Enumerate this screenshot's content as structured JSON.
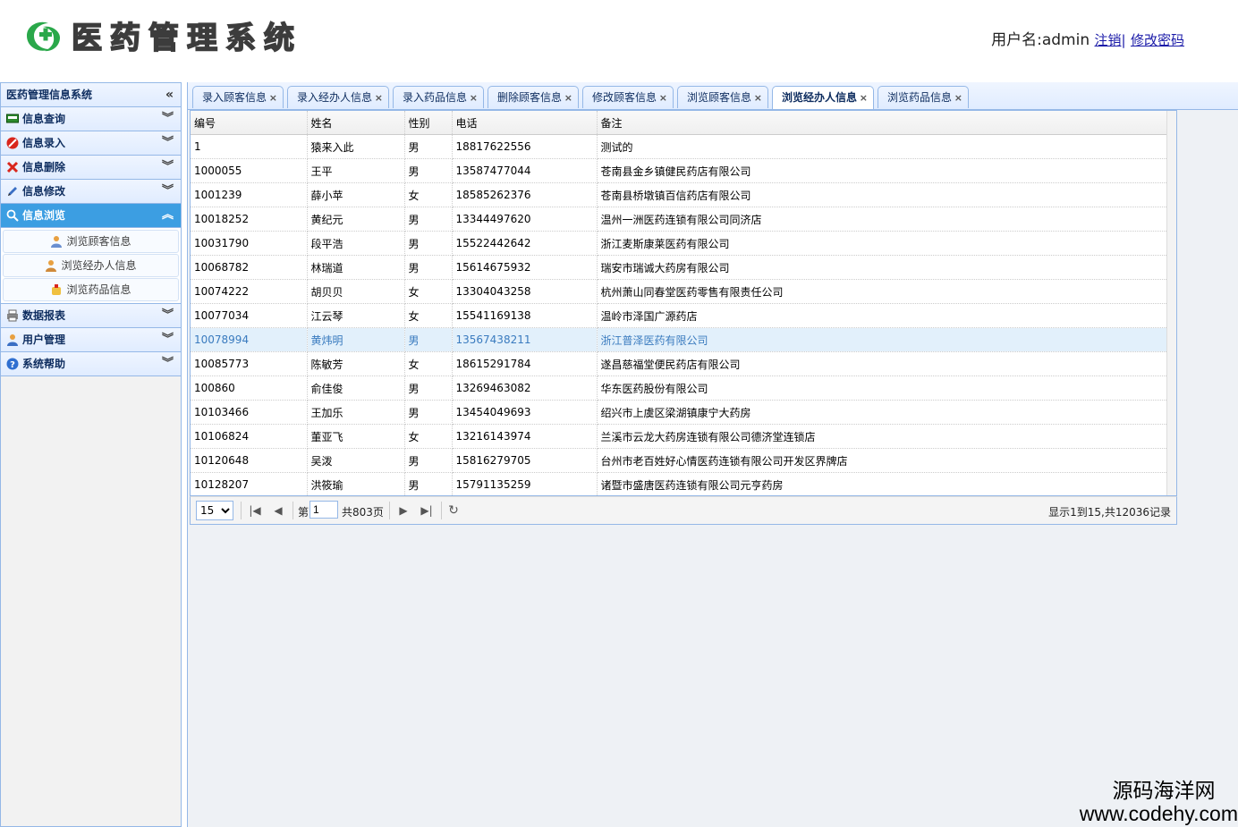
{
  "header": {
    "title": "医药管理系统",
    "user_label": "用户名:admin",
    "logout": "注销",
    "sep": "|",
    "change_password": "修改密码"
  },
  "sidebar": {
    "title": "医药管理信息系统",
    "collapse_icon": "«",
    "sections": [
      {
        "label": "信息查询",
        "icon": "monitor-icon"
      },
      {
        "label": "信息录入",
        "icon": "stop-icon"
      },
      {
        "label": "信息删除",
        "icon": "delete-icon"
      },
      {
        "label": "信息修改",
        "icon": "pencil-icon"
      },
      {
        "label": "信息浏览",
        "icon": "search-icon",
        "active": true
      },
      {
        "label": "数据报表",
        "icon": "printer-icon"
      },
      {
        "label": "用户管理",
        "icon": "user-icon"
      },
      {
        "label": "系统帮助",
        "icon": "help-icon"
      }
    ],
    "subitems": [
      {
        "label": "浏览顾客信息",
        "icon": "customer-icon"
      },
      {
        "label": "浏览经办人信息",
        "icon": "agent-icon"
      },
      {
        "label": "浏览药品信息",
        "icon": "medicine-icon"
      }
    ]
  },
  "tabs": [
    {
      "label": "录入顾客信息"
    },
    {
      "label": "录入经办人信息"
    },
    {
      "label": "录入药品信息"
    },
    {
      "label": "删除顾客信息"
    },
    {
      "label": "修改顾客信息"
    },
    {
      "label": "浏览顾客信息"
    },
    {
      "label": "浏览经办人信息",
      "active": true
    },
    {
      "label": "浏览药品信息"
    }
  ],
  "grid": {
    "columns": [
      "编号",
      "姓名",
      "性别",
      "电话",
      "备注"
    ],
    "rows": [
      [
        "1",
        "猿来入此",
        "男",
        "18817622556",
        "测试的"
      ],
      [
        "1000055",
        "王平",
        "男",
        "13587477044",
        "苍南县金乡镇健民药店有限公司"
      ],
      [
        "1001239",
        "薛小苹",
        "女",
        "18585262376",
        "苍南县桥墩镇百信药店有限公司"
      ],
      [
        "10018252",
        "黄纪元",
        "男",
        "13344497620",
        "温州一洲医药连锁有限公司同济店"
      ],
      [
        "10031790",
        "段平浩",
        "男",
        "15522442642",
        "浙江麦斯康莱医药有限公司"
      ],
      [
        "10068782",
        "林瑞道",
        "男",
        "15614675932",
        "瑞安市瑞诚大药房有限公司"
      ],
      [
        "10074222",
        "胡贝贝",
        "女",
        "13304043258",
        "杭州萧山同春堂医药零售有限责任公司"
      ],
      [
        "10077034",
        "江云琴",
        "女",
        "15541169138",
        "温岭市泽国广源药店"
      ],
      [
        "10078994",
        "黄炜明",
        "男",
        "13567438211",
        "浙江普泽医药有限公司"
      ],
      [
        "10085773",
        "陈敏芳",
        "女",
        "18615291784",
        "遂昌慈福堂便民药店有限公司"
      ],
      [
        "100860",
        "俞佳俊",
        "男",
        "13269463082",
        "华东医药股份有限公司"
      ],
      [
        "10103466",
        "王加乐",
        "男",
        "13454049693",
        "绍兴市上虞区梁湖镇康宁大药房"
      ],
      [
        "10106824",
        "董亚飞",
        "女",
        "13216143974",
        "兰溪市云龙大药房连锁有限公司德济堂连锁店"
      ],
      [
        "10120648",
        "吴泼",
        "男",
        "15816279705",
        "台州市老百姓好心情医药连锁有限公司开发区界牌店"
      ],
      [
        "10128207",
        "洪筱瑜",
        "男",
        "15791135259",
        "诸暨市盛唐医药连锁有限公司元亨药房"
      ]
    ],
    "selected_row": 8
  },
  "pager": {
    "page_size": "15",
    "page_prefix": "第",
    "page_value": "1",
    "page_total": "共803页",
    "info": "显示1到15,共12036记录"
  },
  "watermark": {
    "line1": "源码海洋网",
    "line2": "www.codehy.com"
  },
  "colors": {
    "accent": "#3c9ee2",
    "border": "#95b8e7",
    "logo_green": "#2aa84a"
  }
}
